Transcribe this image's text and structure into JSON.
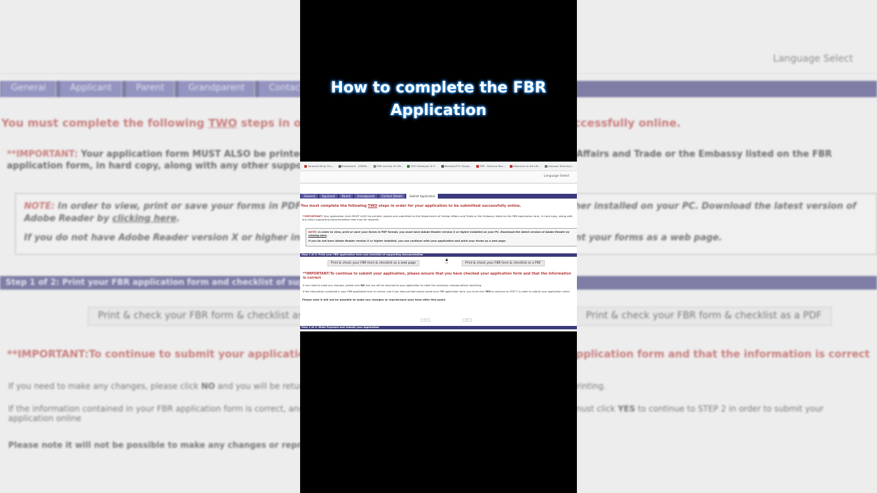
{
  "video": {
    "caption_line1": "How to complete the FBR",
    "caption_line2": "Application"
  },
  "browser": {
    "bookmarks": [
      {
        "label": "Taranaki Ming Chu...",
        "color": "#c0392b"
      },
      {
        "label": "Dashboard - (MARA...",
        "color": "#666666"
      },
      {
        "label": "FBR activity of GM...",
        "color": "#888888"
      },
      {
        "label": "PCR Prototype III P...",
        "color": "#2e7d32"
      },
      {
        "label": "Remote(ZTV Single...",
        "color": "#555555"
      },
      {
        "label": "FBR - Reverse Bac...",
        "color": "#d32f2f"
      },
      {
        "label": "Welcome to the UK...",
        "color": "#c62828"
      },
      {
        "label": "Amazon Directory...",
        "color": "#777777"
      }
    ]
  },
  "page": {
    "language_select": "Language Select",
    "tabs": [
      {
        "label": "General",
        "active": false
      },
      {
        "label": "Applicant",
        "active": false
      },
      {
        "label": "Parent",
        "active": false
      },
      {
        "label": "Grandparent",
        "active": false
      },
      {
        "label": "Contact Details",
        "active": false
      },
      {
        "label": "Submit Application",
        "active": true
      }
    ],
    "heading_pre": "You must complete the following ",
    "heading_two": "TWO",
    "heading_post": " steps in order for your application to be submitted successfully online.",
    "important_label": "**IMPORTANT:",
    "important_text": " Your application form MUST ALSO be printed, signed and submitted to the Department of Foreign Affairs and Trade or the Embassy listed on the FBR application form, in hard copy, along with any other supporting documentation that may be required.",
    "note_label": "NOTE:",
    "note_text": " In order to view, print or save your forms in PDF format, you must have Adobe Reader version X or higher installed on your PC. Download the latest version of Adobe Reader by ",
    "note_link": "clicking here",
    "note_end": ".",
    "note_text2": "If you do not have Adobe Reader version X or higher installed, you can continue with your application and print your forms as a web page.",
    "step1_title": "Step 1 of 2: Print your FBR application form and checklist of supporting documentation",
    "btn_webpage": "Print & check your FBR form & checklist as a web page",
    "or_label": "OR",
    "btn_pdf": "Print & check your FBR form & checklist as a PDF",
    "important2": "**IMPORTANT:To continue to submit your application, please ensure that you have checked your application form and that the information is correct",
    "line1_pre": "If you need to make any changes, please click ",
    "line1_no": "NO",
    "line1_post": " and you will be returned to your application to make the necessary changes before reprinting.",
    "line2_pre": "If the information contained in your FBR application form is correct, and if you have printed and/or saved your FBR application form, you must click ",
    "line2_yes": "YES",
    "line2_post": " to continue to STEP 2 in order to submit your application online",
    "last_line": "Please note it will not be possible to make any changes or reprint/save your form after this point.",
    "yes_label": "Yes",
    "no_label": "No",
    "step2_title": "Step 2 of 2: Make Payment and Submit your Application"
  }
}
